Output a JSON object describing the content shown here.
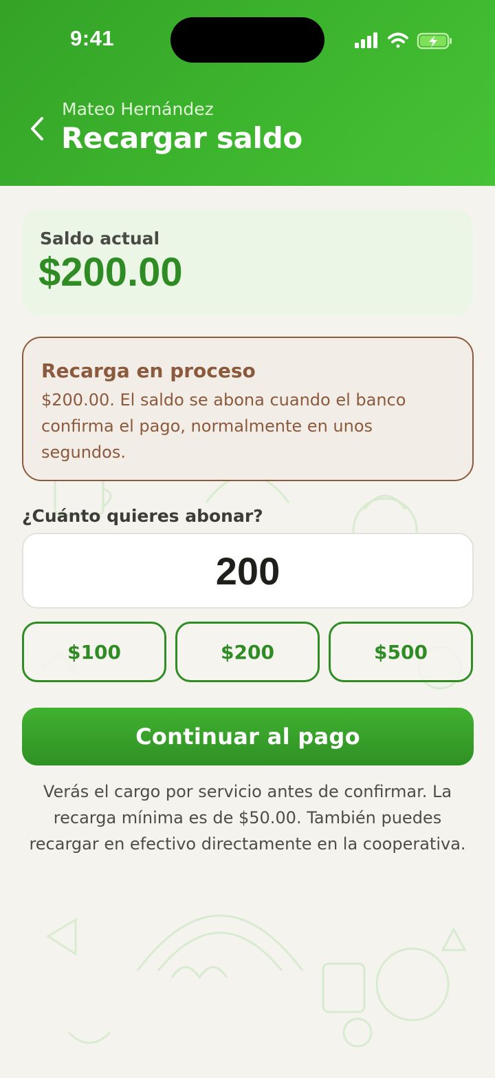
{
  "status_bar": {
    "time": "9:41",
    "icons": [
      "signal-icon",
      "wifi-icon",
      "battery-charging-icon"
    ]
  },
  "header": {
    "back_icon": "chevron-left-icon",
    "subtitle": "Mateo Hernández",
    "title": "Recargar saldo"
  },
  "balance": {
    "label": "Saldo actual",
    "value": "$200.00"
  },
  "alert": {
    "title": "Recarga en proceso",
    "body": "$200.00. El saldo se abona cuando el banco confirma el pago, normalmente en unos segundos."
  },
  "amount": {
    "label": "¿Cuánto quieres abonar?",
    "value": "200"
  },
  "quick_amounts": [
    "$100",
    "$200",
    "$500"
  ],
  "cta": {
    "label": "Continuar al pago"
  },
  "footnote": "Verás el cargo por servicio antes de confirmar. La recarga mínima es de $50.00. También puedes recargar en efectivo directamente en la cooperativa.",
  "colors": {
    "header_green": "#3db52e",
    "accent_green": "#2f8c24",
    "alert_brown": "#8b5a3c",
    "background": "#f5f3ee"
  }
}
